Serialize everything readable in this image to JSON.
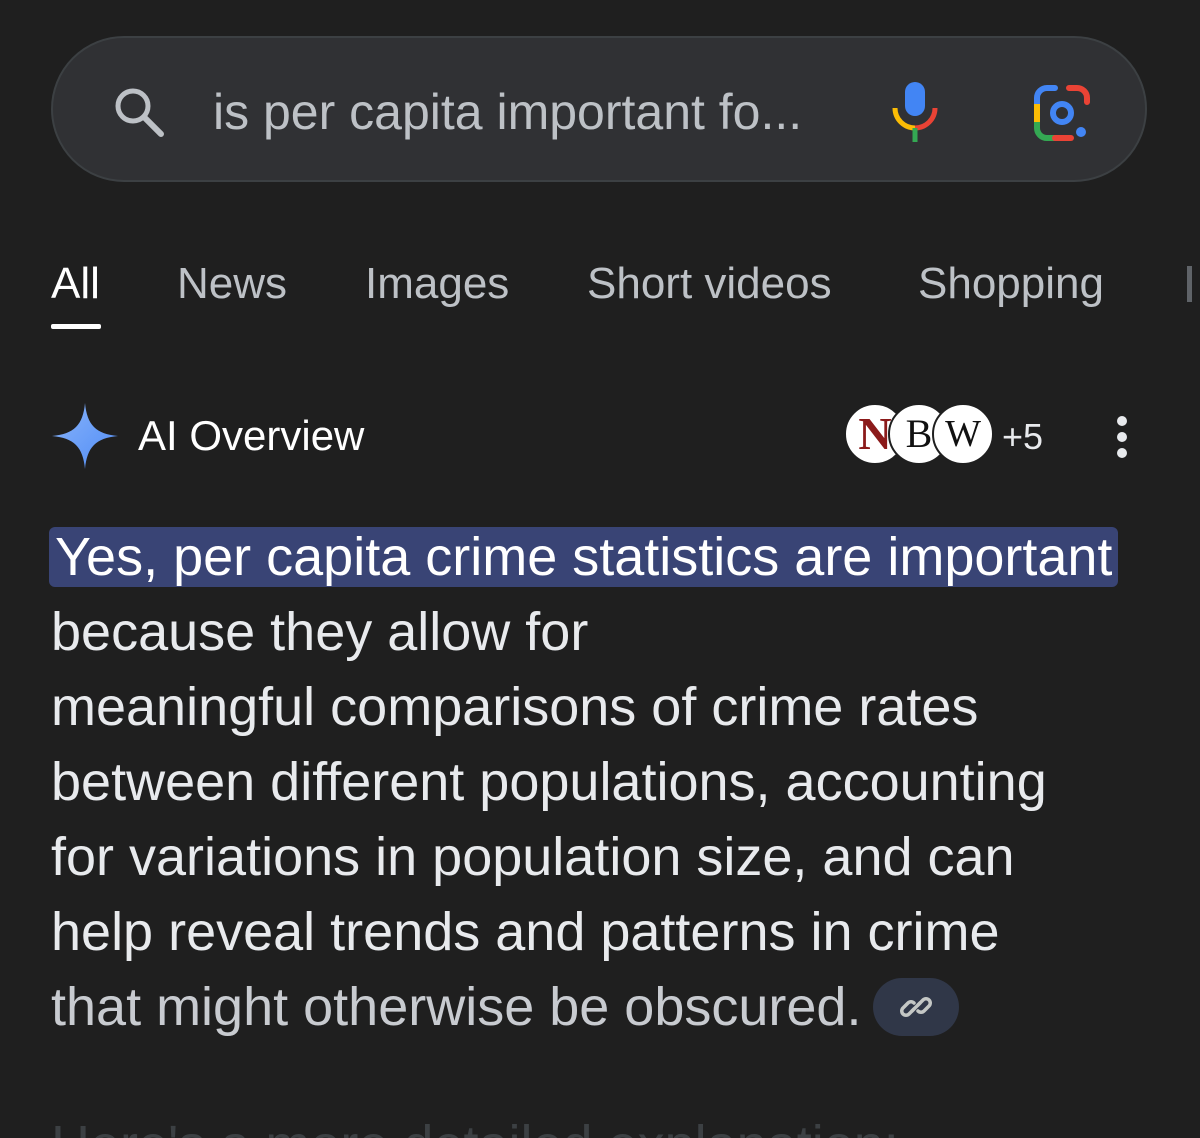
{
  "search": {
    "query": "is per capita important fo..."
  },
  "tabs": [
    {
      "label": "All",
      "active": true
    },
    {
      "label": "News",
      "active": false
    },
    {
      "label": "Images",
      "active": false
    },
    {
      "label": "Short videos",
      "active": false
    },
    {
      "label": "Shopping",
      "active": false
    }
  ],
  "ai_overview": {
    "title": "AI Overview",
    "sources": {
      "avatars": [
        "N",
        "B",
        "W"
      ],
      "more_count": "+5"
    },
    "highlight_text": "Yes, per capita crime statistics are important",
    "lines": [
      " because they allow for",
      "meaningful comparisons of crime rates",
      "between different populations, accounting",
      "for variations in population size, and can",
      "help reveal trends and patterns in crime",
      "that might otherwise be obscured."
    ],
    "next_text_partial": "Here's a more detailed explanation:"
  },
  "icons": {
    "search": "search-icon",
    "mic": "mic-icon",
    "lens": "google-lens-icon",
    "sparkle": "ai-sparkle-icon",
    "menu": "more-vert-icon",
    "link": "link-icon"
  },
  "colors": {
    "background": "#1f1f1f",
    "search_bar": "#303134",
    "highlight": "#394475",
    "text": "#e8eaed",
    "tab_inactive": "#bdc1c6"
  }
}
